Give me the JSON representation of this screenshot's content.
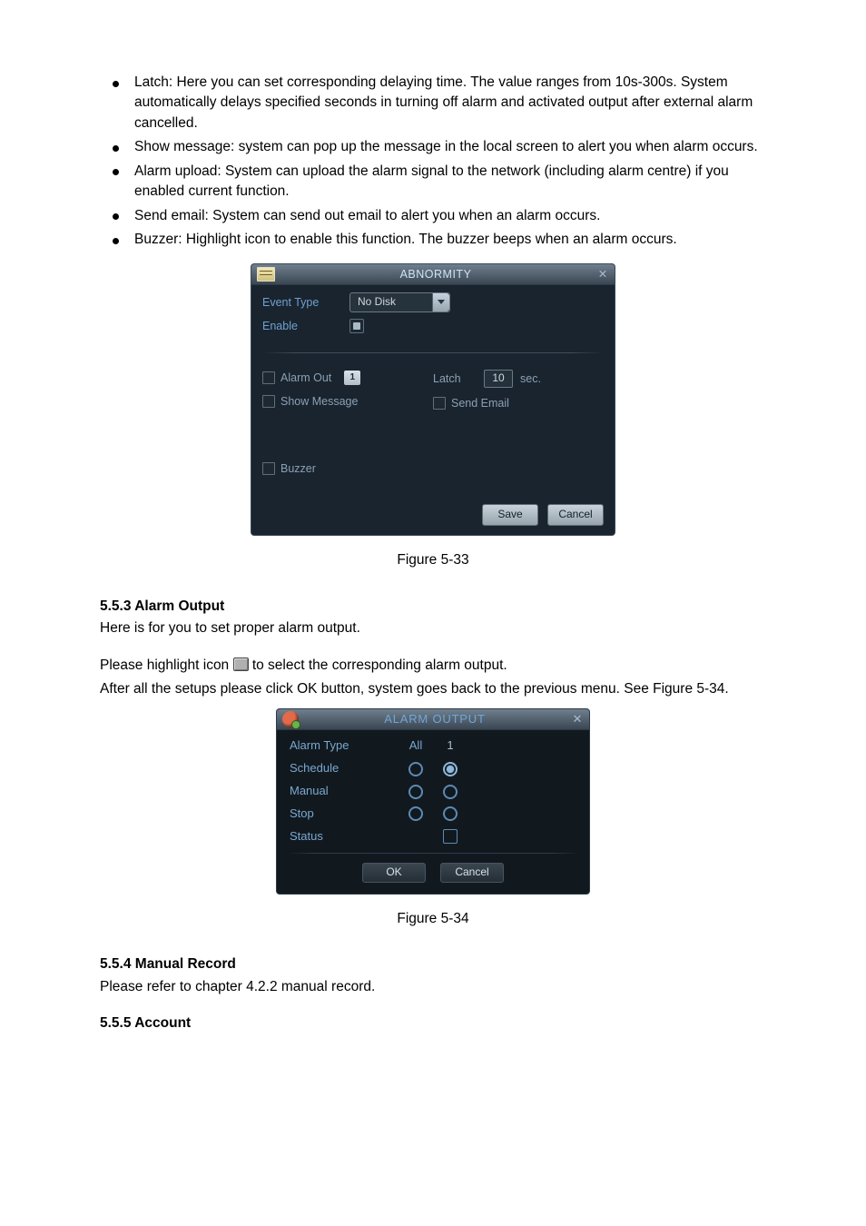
{
  "bullets": [
    "Latch: Here you can set corresponding delaying time. The value ranges from 10s-300s. System automatically delays specified seconds in turning off alarm and activated output after external alarm cancelled.",
    "Show message: system can pop up the message in the local screen to alert you when alarm occurs.",
    "Alarm upload: System can upload the alarm signal to the network (including alarm centre) if you enabled current function.",
    "Send email: System can send out email to alert you when an alarm occurs.",
    "Buzzer: Highlight icon to enable this function. The buzzer beeps when an alarm occurs."
  ],
  "abnormity": {
    "title": "ABNORMITY",
    "eventTypeLabel": "Event Type",
    "eventTypeValue": "No Disk",
    "enableLabel": "Enable",
    "alarmOutLabel": "Alarm Out",
    "alarmOutBadge": "1",
    "latchLabel": "Latch",
    "latchValue": "10",
    "latchUnit": "sec.",
    "showMessageLabel": "Show Message",
    "sendEmailLabel": "Send Email",
    "buzzerLabel": "Buzzer",
    "save": "Save",
    "cancel": "Cancel"
  },
  "captions": {
    "fig533": "Figure 5-33",
    "fig534": "Figure 5-34"
  },
  "sections": {
    "alarmOutputHeading": "5.5.3  Alarm Output",
    "alarmOutputP1": "Here is for you to set proper alarm output.",
    "alarmOutputP2a": "Please highlight icon ",
    "alarmOutputP2b": " to select the corresponding alarm output.",
    "alarmOutputP3": "After all the setups please click OK button, system goes back to the previous menu. See Figure 5-34.",
    "manualRecordHeading": "5.5.4  Manual Record",
    "manualRecordP1": "Please refer to chapter 4.2.2 manual record.",
    "accountHeading": "5.5.5  Account"
  },
  "alarmOutput": {
    "title": "ALARM OUTPUT",
    "rowAlarmType": "Alarm Type",
    "colAll": "All",
    "col1": "1",
    "rowSchedule": "Schedule",
    "rowManual": "Manual",
    "rowStop": "Stop",
    "rowStatus": "Status",
    "ok": "OK",
    "cancel": "Cancel"
  }
}
